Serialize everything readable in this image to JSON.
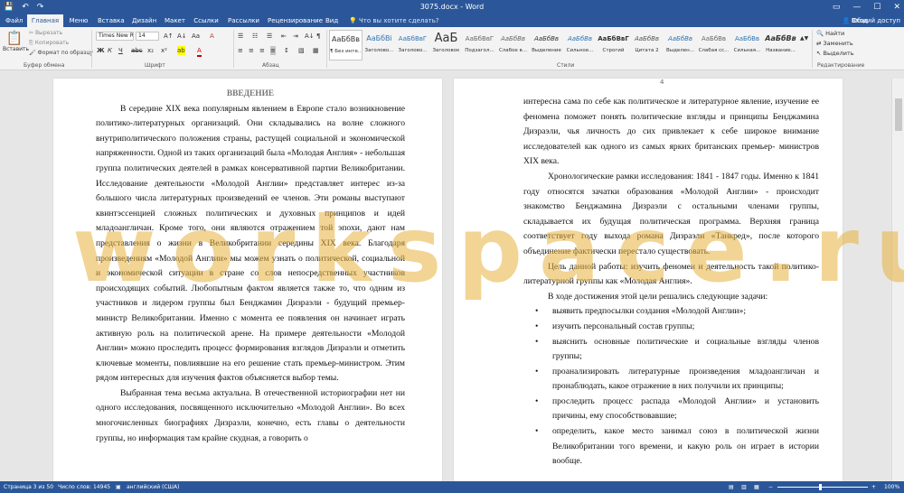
{
  "title": "3075.docx - Word",
  "qat": {
    "save": "💾",
    "undo": "↶",
    "redo": "↷"
  },
  "window_controls": {
    "ribbon_options": "▭",
    "minimize": "—",
    "maximize": "☐",
    "close": "✕"
  },
  "tabs": [
    "Файл",
    "Главная",
    "Меню",
    "Вставка",
    "Дизайн",
    "Макет",
    "Ссылки",
    "Рассылки",
    "Рецензирование",
    "Вид"
  ],
  "active_tab": "Главная",
  "tell_me": "Что вы хотите сделать?",
  "account": "Вход",
  "share": "Общий доступ",
  "clipboard": {
    "paste": "Вставить",
    "cut": "Вырезать",
    "copy": "Копировать",
    "format_painter": "Формат по образцу",
    "label": "Буфер обмена"
  },
  "font": {
    "name": "Times New R",
    "size": "14",
    "label": "Шрифт",
    "bold": "Ж",
    "italic": "К",
    "underline": "Ч",
    "strike": "abc",
    "sub": "x₂",
    "sup": "x²",
    "grow": "A↑",
    "shrink": "A↓",
    "case": "Aa",
    "clear": "A",
    "highlight": "ab",
    "color": "A"
  },
  "paragraph": {
    "label": "Абзац",
    "bullets": "☰",
    "numbering": "☷",
    "multilevel": "☰",
    "decrease": "⇤",
    "increase": "⇥",
    "sort": "A↓",
    "marks": "¶",
    "align_left": "≡",
    "center": "≡",
    "align_right": "≡",
    "justify": "≡",
    "spacing": "↕",
    "shading": "▧",
    "borders": "▦"
  },
  "styles": {
    "label": "Стили",
    "items": [
      {
        "preview": "АаБбВв",
        "name": "¶ Без инте..."
      },
      {
        "preview": "АаБбВі",
        "name": "Заголово..."
      },
      {
        "preview": "АаБбВвГ",
        "name": "Заголово..."
      },
      {
        "preview": "АаБ",
        "name": "Заголовок"
      },
      {
        "preview": "АаБбВвГ",
        "name": "Подзагол..."
      },
      {
        "preview": "АаБбВв",
        "name": "Слабое в..."
      },
      {
        "preview": "АаБбВв",
        "name": "Выделение"
      },
      {
        "preview": "АаБбВв",
        "name": "Сильное..."
      },
      {
        "preview": "АаБбВвГ",
        "name": "Строгий"
      },
      {
        "preview": "АаБбВв",
        "name": "Цитата 2"
      },
      {
        "preview": "АаБбВв",
        "name": "Выделен..."
      },
      {
        "preview": "АаБбВв",
        "name": "Слабая сс..."
      },
      {
        "preview": "АаБбВв",
        "name": "Сильная..."
      },
      {
        "preview": "АаБбВв",
        "name": "Название..."
      }
    ]
  },
  "editing": {
    "find": "Найти",
    "replace": "Заменить",
    "select": "Выделить",
    "label": "Редактирование"
  },
  "pages": {
    "left_num": "3",
    "right_num": "4",
    "left_heading": "ВВЕДЕНИЕ",
    "left_paras": [
      "В середине XIX века популярным явлением в Европе стало возникновение политико-литературных организаций. Они складывались на волне сложного внутриполитического положения страны, растущей социальной и экономической напряженности. Одной из таких организаций была «Молодая Англия» - небольшая группа политических деятелей в рамках консервативной партии Великобритании. Исследование деятельности «Молодой Англии» представляет интерес из-за большого числа литературных произведений ее членов. Эти романы выступают квинтэссенцией сложных политических и духовных принципов и идей младоангличан. Кроме того, они являются отражением той эпохи, дают нам представления о жизни в Великобритании середины XIX века. Благодаря произведениям «Молодой Англии» мы можем узнать о политической, социальной и экономической ситуации в стране со слов непосредственных участников происходящих событий. Любопытным фактом является также то, что одним из участников и лидером группы был Бенджамин Дизраэли - будущий премьер-министр Великобритании. Именно с момента ее появления он начинает играть активную роль на политической арене. На примере деятельности «Молодой Англии» можно проследить процесс формирования взглядов Дизраэли и отметить ключевые моменты, повлиявшие на его решение стать премьер-министром. Этим рядом интересных для изучения фактов объясняется выбор темы.",
      "Выбранная тема весьма актуальна. В отечественной историографии нет ни одного исследования, посвященного исключительно «Молодой Англии». Во всех многочисленных биографиях Дизраэли, конечно, есть главы о деятельности группы, но информация там крайне скудная, а говорить о"
    ],
    "right_top": "интересна сама по себе как политическое и литературное явление, изучение ее феномена поможет понять политические взгляды и принципы Бенджамина Дизраэли, чья личность до сих привлекает к себе широкое внимание исследователей как одного из самых ярких британских премьер- министров XIX века.",
    "right_paras": [
      "Хронологические рамки исследования: 1841 - 1847 годы. Именно к 1841 году относятся зачатки образования «Молодой Англии» - происходит знакомство Бенджамина Дизраэли с остальными членами группы, складывается их будущая политическая программа. Верхняя граница соответствует году выхода романа Дизраэли «Танкред», после которого объединение фактически перестало существовать.",
      "Цель данной работы: изучить феномен и деятельность такой политико-литературной группы как «Молодая Англия».",
      "В ходе достижения этой цели решались следующие задачи:"
    ],
    "bullets": [
      "выявить предпосылки создания «Молодой Англии»;",
      "изучить персональный состав группы;",
      "выяснить основные политические и социальные взгляды членов группы;",
      "проанализировать литературные произведения младоангличан и пронаблюдать, какое отражение в них получили их принципы;",
      "проследить процесс распада «Молодой Англии» и установить причины, ему способствовавшие;",
      "определить, какое место занимал союз в политической жизни Великобритании того времени, и какую роль он играет в истории вообще."
    ]
  },
  "watermark": "workspace.ru",
  "status": {
    "page": "Страница 3 из 50",
    "words": "Число слов: 14945",
    "language": "английский (США)",
    "zoom": "100%"
  },
  "colors": {
    "accent": "#2b579a",
    "watermark": "#e7b03c"
  }
}
